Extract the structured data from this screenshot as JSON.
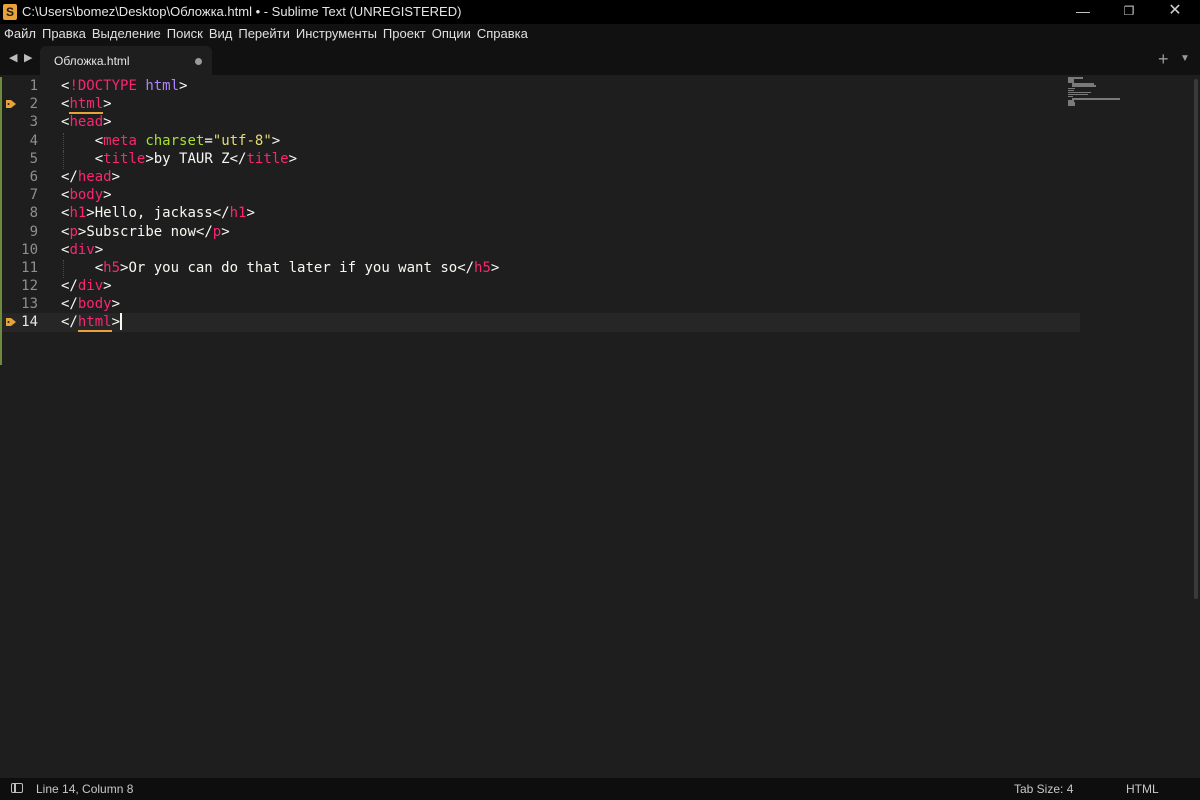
{
  "window": {
    "title": "C:\\Users\\bomez\\Desktop\\Обложка.html • - Sublime Text (UNREGISTERED)",
    "app_icon": "sublime-icon",
    "minimize_glyph": "—",
    "maximize_glyph": "❐",
    "close_glyph": "✕"
  },
  "menu": {
    "items": [
      "Файл",
      "Правка",
      "Выделение",
      "Поиск",
      "Вид",
      "Перейти",
      "Инструменты",
      "Проект",
      "Опции",
      "Справка"
    ]
  },
  "tabs": {
    "nav_back": "◀",
    "nav_forward": "▶",
    "active_tab": {
      "label": "Обложка.html",
      "dirty": true
    },
    "new_tab": "+",
    "dropdown": "▼"
  },
  "editor": {
    "active_line": 14,
    "bookmarked_lines": [
      2,
      14
    ],
    "line_numbers": [
      "1",
      "2",
      "3",
      "4",
      "5",
      "6",
      "7",
      "8",
      "9",
      "10",
      "11",
      "12",
      "13",
      "14"
    ],
    "lines": [
      [
        {
          "t": "<",
          "c": "punct"
        },
        {
          "t": "!DOCTYPE",
          "c": "doctype"
        },
        {
          "t": " ",
          "c": "text"
        },
        {
          "t": "html",
          "c": "doctype-val"
        },
        {
          "t": ">",
          "c": "punct"
        }
      ],
      [
        {
          "t": "<",
          "c": "punct"
        },
        {
          "t": "html",
          "c": "tag",
          "m": true
        },
        {
          "t": ">",
          "c": "punct"
        }
      ],
      [
        {
          "t": "<",
          "c": "punct"
        },
        {
          "t": "head",
          "c": "tag"
        },
        {
          "t": ">",
          "c": "punct"
        }
      ],
      [
        {
          "t": "    ",
          "c": "indent"
        },
        {
          "t": "<",
          "c": "punct"
        },
        {
          "t": "meta",
          "c": "tag"
        },
        {
          "t": " ",
          "c": "text"
        },
        {
          "t": "charset",
          "c": "attr"
        },
        {
          "t": "=",
          "c": "punct"
        },
        {
          "t": "\"utf-8\"",
          "c": "str"
        },
        {
          "t": ">",
          "c": "punct"
        }
      ],
      [
        {
          "t": "    ",
          "c": "indent"
        },
        {
          "t": "<",
          "c": "punct"
        },
        {
          "t": "title",
          "c": "tag"
        },
        {
          "t": ">",
          "c": "punct"
        },
        {
          "t": "by TAUR Z",
          "c": "text"
        },
        {
          "t": "</",
          "c": "punct"
        },
        {
          "t": "title",
          "c": "tag"
        },
        {
          "t": ">",
          "c": "punct"
        }
      ],
      [
        {
          "t": "</",
          "c": "punct"
        },
        {
          "t": "head",
          "c": "tag"
        },
        {
          "t": ">",
          "c": "punct"
        }
      ],
      [
        {
          "t": "<",
          "c": "punct"
        },
        {
          "t": "body",
          "c": "tag"
        },
        {
          "t": ">",
          "c": "punct"
        }
      ],
      [
        {
          "t": "<",
          "c": "punct"
        },
        {
          "t": "h1",
          "c": "tag"
        },
        {
          "t": ">",
          "c": "punct"
        },
        {
          "t": "Hello, jackass",
          "c": "text"
        },
        {
          "t": "</",
          "c": "punct"
        },
        {
          "t": "h1",
          "c": "tag"
        },
        {
          "t": ">",
          "c": "punct"
        }
      ],
      [
        {
          "t": "<",
          "c": "punct"
        },
        {
          "t": "p",
          "c": "tag"
        },
        {
          "t": ">",
          "c": "punct"
        },
        {
          "t": "Subscribe now",
          "c": "text"
        },
        {
          "t": "</",
          "c": "punct"
        },
        {
          "t": "p",
          "c": "tag"
        },
        {
          "t": ">",
          "c": "punct"
        }
      ],
      [
        {
          "t": "<",
          "c": "punct"
        },
        {
          "t": "div",
          "c": "tag"
        },
        {
          "t": ">",
          "c": "punct"
        }
      ],
      [
        {
          "t": "    ",
          "c": "indent"
        },
        {
          "t": "<",
          "c": "punct"
        },
        {
          "t": "h5",
          "c": "tag"
        },
        {
          "t": ">",
          "c": "punct"
        },
        {
          "t": "Or you can do that later if you want so",
          "c": "text"
        },
        {
          "t": "</",
          "c": "punct"
        },
        {
          "t": "h5",
          "c": "tag"
        },
        {
          "t": ">",
          "c": "punct"
        }
      ],
      [
        {
          "t": "</",
          "c": "punct"
        },
        {
          "t": "div",
          "c": "tag"
        },
        {
          "t": ">",
          "c": "punct"
        }
      ],
      [
        {
          "t": "</",
          "c": "punct"
        },
        {
          "t": "body",
          "c": "tag"
        },
        {
          "t": ">",
          "c": "punct"
        }
      ],
      [
        {
          "t": "</",
          "c": "punct"
        },
        {
          "t": "html",
          "c": "tag",
          "m": true
        },
        {
          "t": ">",
          "c": "punct"
        }
      ]
    ]
  },
  "colors": {
    "background": "#1e1e1e",
    "tag": "#f92672",
    "attribute": "#a6e22e",
    "string": "#e6db74",
    "doctype_value": "#ae81ff",
    "text": "#f8f8f2",
    "bracket_match": "#e8a23a",
    "bookmark": "#e8a23a",
    "modified_marker": "#6e8b3d"
  },
  "status": {
    "panel_icon": "panel-switcher-icon",
    "position": "Line 14, Column 8",
    "tab_size": "Tab Size: 4",
    "syntax": "HTML"
  }
}
